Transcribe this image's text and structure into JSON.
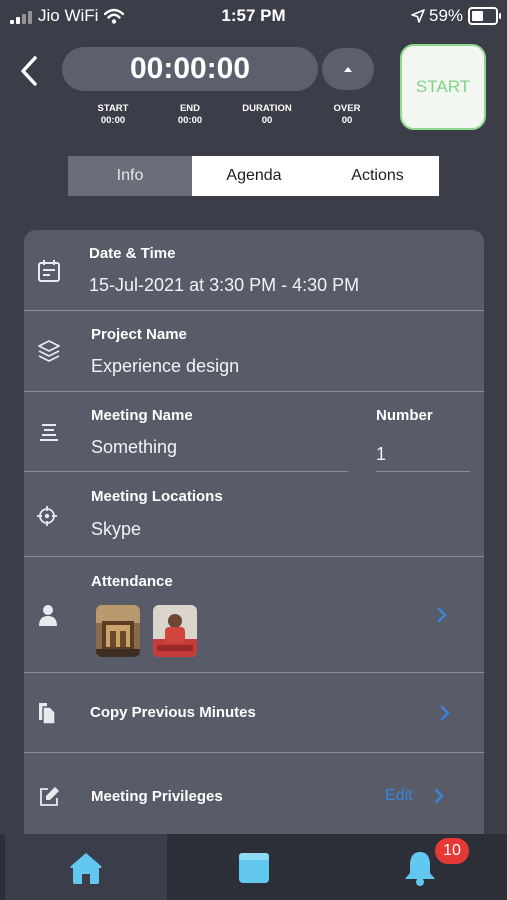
{
  "status_bar": {
    "carrier": "Jio WiFi",
    "time": "1:57 PM",
    "battery": "59%",
    "battery_level": 0.59
  },
  "timer": {
    "display": "00:00:00",
    "start_button_label": "START",
    "stats": [
      {
        "label": "START",
        "value": "00:00"
      },
      {
        "label": "END",
        "value": "00:00"
      },
      {
        "label": "DURATION",
        "value": "00"
      },
      {
        "label": "OVER",
        "value": "00"
      }
    ]
  },
  "tabs": [
    {
      "label": "Info",
      "active": true
    },
    {
      "label": "Agenda",
      "active": false
    },
    {
      "label": "Actions",
      "active": false
    }
  ],
  "info": {
    "date_time": {
      "label": "Date & Time",
      "value": "15-Jul-2021 at 3:30 PM - 4:30 PM"
    },
    "project": {
      "label": "Project Name",
      "value": "Experience design"
    },
    "meeting_name": {
      "label": "Meeting Name",
      "value": "Something"
    },
    "number": {
      "label": "Number",
      "value": "1"
    },
    "location": {
      "label": "Meeting Locations",
      "value": "Skype"
    },
    "attendance": {
      "label": "Attendance",
      "attendees": [
        "attendee-1",
        "attendee-2"
      ]
    },
    "copy_previous": {
      "label": "Copy Previous Minutes"
    },
    "privileges": {
      "label": "Meeting Privileges",
      "edit_label": "Edit"
    }
  },
  "bottom_nav": {
    "items": [
      "home",
      "calendar",
      "notifications"
    ],
    "notification_count": "10"
  },
  "colors": {
    "background": "#3b3d48",
    "card": "#585b68",
    "accent_green": "#7fd487",
    "link_blue": "#3a83de",
    "icon_blue": "#62c8f0",
    "badge_red": "#e53935"
  }
}
